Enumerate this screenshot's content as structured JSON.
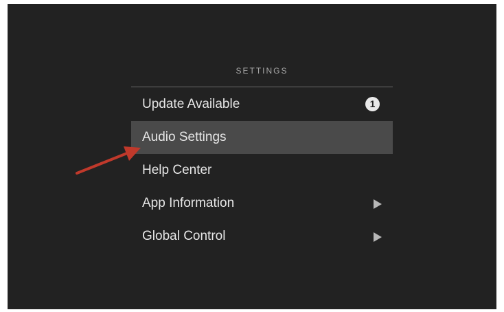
{
  "settings_menu": {
    "title": "SETTINGS",
    "items": [
      {
        "label": "Update Available",
        "badge": "1"
      },
      {
        "label": "Audio Settings",
        "selected": true
      },
      {
        "label": "Help Center"
      },
      {
        "label": "App Information",
        "submenu": true
      },
      {
        "label": "Global Control",
        "submenu": true
      }
    ]
  },
  "annotation": {
    "color": "#c0392b",
    "target": "Audio Settings"
  },
  "colors": {
    "panel_bg": "#222222",
    "selected_bg": "#4a4a4a",
    "text": "#e6e6e6",
    "title_text": "#a6a6a6"
  }
}
